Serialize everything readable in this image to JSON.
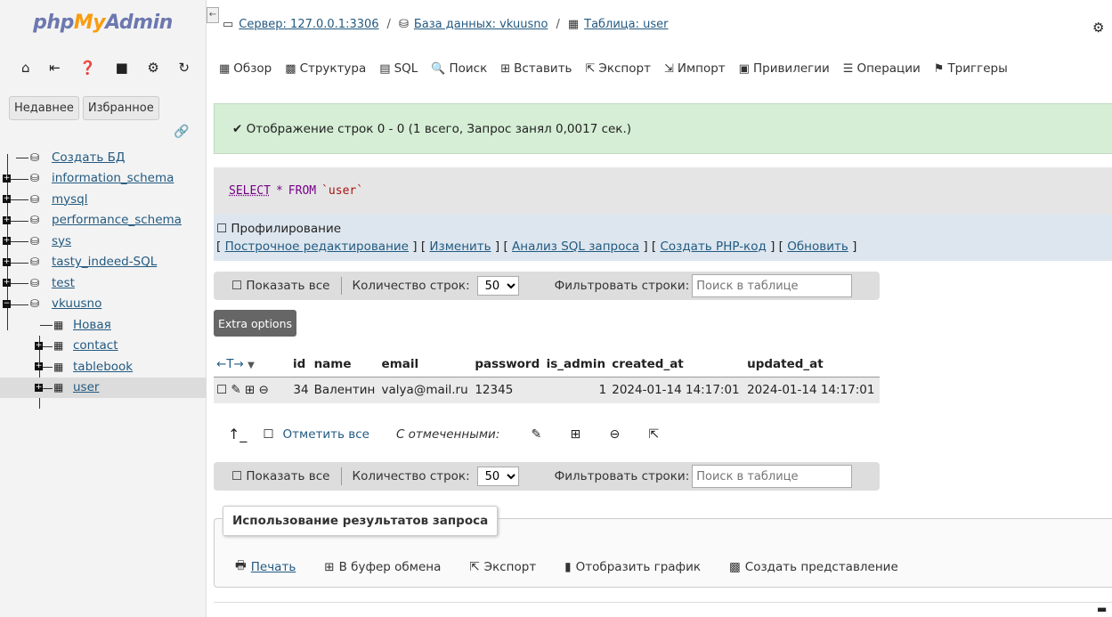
{
  "logo": {
    "php": "php",
    "my": "My",
    "admin": "Admin"
  },
  "left_icons": [
    "home-icon",
    "logout-icon",
    "help-icon",
    "docs-icon",
    "settings-icon",
    "reload-icon"
  ],
  "left_icon_glyphs": [
    "⌂",
    "⇤",
    "❓",
    "■",
    "⚙",
    "↻"
  ],
  "left_tabs": {
    "recent": "Недавнее",
    "favorites": "Избранное"
  },
  "tree": {
    "create_db": "Создать БД",
    "databases": [
      "information_schema",
      "mysql",
      "performance_schema",
      "sys",
      "tasty_indeed-SQL",
      "test",
      "vkuusno"
    ],
    "tables": {
      "new": "Новая",
      "items": [
        "contact",
        "tablebook",
        "user"
      ]
    }
  },
  "breadcrumb": {
    "server": "Сервер: 127.0.0.1:3306",
    "database": "База данных: vkuusno",
    "table": "Таблица: user"
  },
  "menu": [
    {
      "label": "Обзор",
      "icon": "▦"
    },
    {
      "label": "Структура",
      "icon": "▩"
    },
    {
      "label": "SQL",
      "icon": "▤"
    },
    {
      "label": "Поиск",
      "icon": "🔍"
    },
    {
      "label": "Вставить",
      "icon": "⊞"
    },
    {
      "label": "Экспорт",
      "icon": "⇱"
    },
    {
      "label": "Импорт",
      "icon": "⇲"
    },
    {
      "label": "Привилегии",
      "icon": "▣"
    },
    {
      "label": "Операции",
      "icon": "☰"
    },
    {
      "label": "Триггеры",
      "icon": "⚑"
    }
  ],
  "notice": "✔ Отображение строк 0 - 0 (1 всего, Запрос занял 0,0017 сек.)",
  "sql": {
    "select": "SELECT",
    "star": "*",
    "from": "FROM",
    "table": "`user`"
  },
  "sql_options": {
    "profiling": "Профилирование",
    "links": [
      "Построчное редактирование",
      "Изменить",
      "Анализ SQL запроса",
      "Создать PHP-код",
      "Обновить"
    ]
  },
  "nav": {
    "show_all": "Показать все",
    "rows_label": "Количество строк:",
    "rows_value": "50",
    "filter_label": "Фильтровать строки:",
    "filter_placeholder": "Поиск в таблице"
  },
  "extra_options": "Extra options",
  "table": {
    "columns": [
      "id",
      "name",
      "email",
      "password",
      "is_admin",
      "created_at",
      "updated_at"
    ],
    "rows": [
      {
        "id": "34",
        "name": "Валентин",
        "email": "valya@mail.ru",
        "password": "12345",
        "is_admin": "1",
        "created_at": "2024-01-14 14:17:01",
        "updated_at": "2024-01-14 14:17:01"
      }
    ]
  },
  "bulk": {
    "check_all": "Отметить все",
    "with_selected": "С отмеченными:"
  },
  "usage": {
    "title": "Использование результатов запроса",
    "actions": [
      {
        "label": "Печать",
        "icon": "🖶"
      },
      {
        "label": "В буфер обмена",
        "icon": "⊞"
      },
      {
        "label": "Экспорт",
        "icon": "⇱"
      },
      {
        "label": "Отобразить график",
        "icon": "▮"
      },
      {
        "label": "Создать представление",
        "icon": "▩"
      }
    ]
  },
  "colors": {
    "accent": "#235a81",
    "notice_bg": "#d5eed5",
    "logo_blue": "#6c78af",
    "logo_orange": "#f89c0e"
  }
}
